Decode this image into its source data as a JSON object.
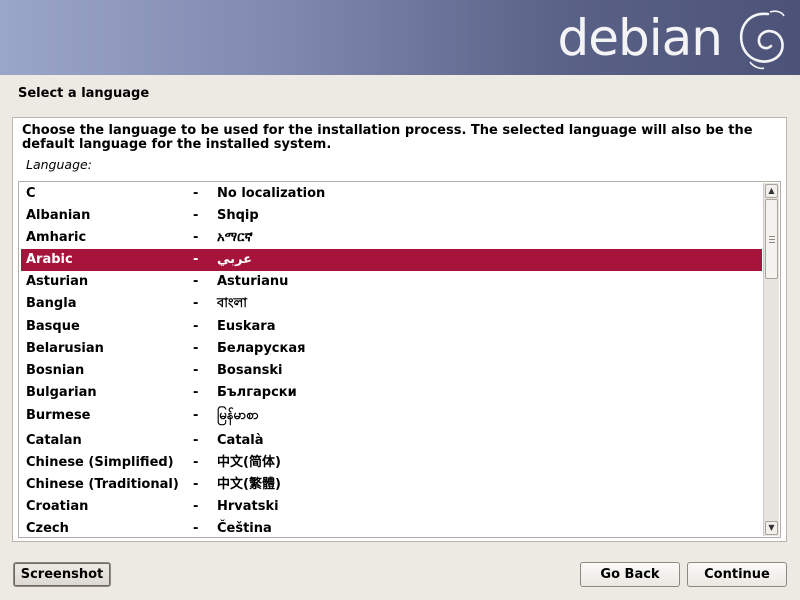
{
  "banner": {
    "logo_text": "debian"
  },
  "step_title": "Select a language",
  "description": "Choose the language to be used for the installation process. The selected language will also be the default language for the installed system.",
  "field_label": "Language:",
  "selected_index": 3,
  "languages": [
    {
      "name": "C",
      "native": "No localization"
    },
    {
      "name": "Albanian",
      "native": "Shqip"
    },
    {
      "name": "Amharic",
      "native": "አማርኛ"
    },
    {
      "name": "Arabic",
      "native": "عربي"
    },
    {
      "name": "Asturian",
      "native": "Asturianu"
    },
    {
      "name": "Bangla",
      "native": "বাংলা"
    },
    {
      "name": "Basque",
      "native": "Euskara"
    },
    {
      "name": "Belarusian",
      "native": "Беларуская"
    },
    {
      "name": "Bosnian",
      "native": "Bosanski"
    },
    {
      "name": "Bulgarian",
      "native": "Български"
    },
    {
      "name": "Burmese",
      "native": "မြန်မာစာ"
    },
    {
      "name": "Catalan",
      "native": "Català"
    },
    {
      "name": "Chinese (Simplified)",
      "native": "中文(简体)"
    },
    {
      "name": "Chinese (Traditional)",
      "native": "中文(繁體)"
    },
    {
      "name": "Croatian",
      "native": "Hrvatski"
    },
    {
      "name": "Czech",
      "native": "Čeština"
    }
  ],
  "separator": "-",
  "buttons": {
    "screenshot": "Screenshot",
    "go_back": "Go Back",
    "continue": "Continue"
  },
  "colors": {
    "selection": "#a6133b",
    "background": "#ede9e3"
  },
  "icons": {
    "scroll_up": "arrow-up-icon",
    "scroll_down": "arrow-down-icon",
    "logo": "debian-swirl-icon"
  }
}
